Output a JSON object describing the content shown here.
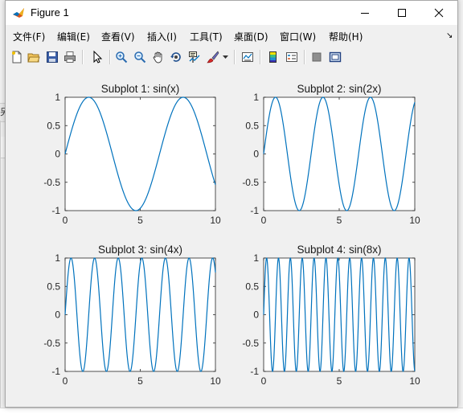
{
  "window": {
    "title": "Figure 1"
  },
  "menubar": {
    "items": [
      {
        "label": "文件(F)",
        "name": "menu-file"
      },
      {
        "label": "编辑(E)",
        "name": "menu-edit"
      },
      {
        "label": "查看(V)",
        "name": "menu-view"
      },
      {
        "label": "插入(I)",
        "name": "menu-insert"
      },
      {
        "label": "工具(T)",
        "name": "menu-tools"
      },
      {
        "label": "桌面(D)",
        "name": "menu-desktop"
      },
      {
        "label": "窗口(W)",
        "name": "menu-window"
      },
      {
        "label": "帮助(H)",
        "name": "menu-help"
      }
    ]
  },
  "toolbar": {
    "icons": [
      "new-figure-icon",
      "open-file-icon",
      "save-icon",
      "print-icon",
      "select-arrow-icon",
      "zoom-in-icon",
      "zoom-out-icon",
      "pan-hand-icon",
      "rotate-3d-icon",
      "data-cursor-icon",
      "brush-icon",
      "brush-dropdown-icon",
      "link-plot-icon",
      "insert-colorbar-icon",
      "insert-legend-icon",
      "hide-plot-tools-icon",
      "show-plot-tools-icon"
    ]
  },
  "colors": {
    "line": "#0072bd",
    "axes_bg": "#ffffff",
    "figure_bg": "#f0f0f0"
  },
  "chart_data": [
    {
      "type": "line",
      "title": "Subplot 1: sin(x)",
      "function": "sin(x)",
      "frequency": 1,
      "x": [
        0.0,
        0.5,
        1.0,
        1.5,
        2.0,
        2.5,
        3.0,
        3.5,
        4.0,
        4.5,
        5.0,
        5.5,
        6.0,
        6.5,
        7.0,
        7.5,
        8.0,
        8.5,
        9.0,
        9.5,
        10.0
      ],
      "y": [
        0.0,
        0.479,
        0.841,
        0.997,
        0.909,
        0.598,
        0.141,
        -0.351,
        -0.757,
        -0.978,
        -0.959,
        -0.706,
        -0.279,
        0.215,
        0.657,
        0.938,
        0.989,
        0.798,
        0.412,
        -0.075,
        -0.544
      ],
      "xlim": [
        0,
        10
      ],
      "ylim": [
        -1,
        1
      ],
      "xticks": [
        "0",
        "5",
        "10"
      ],
      "yticks": [
        "1",
        "0.5",
        "0",
        "-0.5",
        "-1"
      ],
      "grid": false
    },
    {
      "type": "line",
      "title": "Subplot 2: sin(2x)",
      "function": "sin(2x)",
      "frequency": 2,
      "x": [
        0.0,
        0.5,
        1.0,
        1.5,
        2.0,
        2.5,
        3.0,
        3.5,
        4.0,
        4.5,
        5.0,
        5.5,
        6.0,
        6.5,
        7.0,
        7.5,
        8.0,
        8.5,
        9.0,
        9.5,
        10.0
      ],
      "y": [
        0.0,
        0.841,
        0.909,
        0.141,
        -0.757,
        -0.959,
        -0.279,
        0.657,
        0.989,
        0.412,
        -0.544,
        -1.0,
        -0.537,
        0.42,
        0.991,
        0.65,
        -0.288,
        -0.961,
        -0.751,
        0.15,
        0.913
      ],
      "xlim": [
        0,
        10
      ],
      "ylim": [
        -1,
        1
      ],
      "xticks": [
        "0",
        "5",
        "10"
      ],
      "yticks": [
        "1",
        "0.5",
        "0",
        "-0.5",
        "-1"
      ],
      "grid": false
    },
    {
      "type": "line",
      "title": "Subplot 3: sin(4x)",
      "function": "sin(4x)",
      "frequency": 4,
      "x": [
        0.0,
        0.5,
        1.0,
        1.5,
        2.0,
        2.5,
        3.0,
        3.5,
        4.0,
        4.5,
        5.0,
        5.5,
        6.0,
        6.5,
        7.0,
        7.5,
        8.0,
        8.5,
        9.0,
        9.5,
        10.0
      ],
      "y": [
        0.0,
        0.909,
        -0.757,
        -0.279,
        0.989,
        -0.544,
        -0.537,
        0.991,
        -0.288,
        -0.751,
        0.913,
        0.009,
        -0.906,
        0.762,
        0.271,
        -0.988,
        0.551,
        0.529,
        -0.992,
        0.296,
        0.745
      ],
      "xlim": [
        0,
        10
      ],
      "ylim": [
        -1,
        1
      ],
      "xticks": [
        "0",
        "5",
        "10"
      ],
      "yticks": [
        "1",
        "0.5",
        "0",
        "-0.5",
        "-1"
      ],
      "grid": false
    },
    {
      "type": "line",
      "title": "Subplot 4: sin(8x)",
      "function": "sin(8x)",
      "frequency": 8,
      "x": [
        0.0,
        0.5,
        1.0,
        1.5,
        2.0,
        2.5,
        3.0,
        3.5,
        4.0,
        4.5,
        5.0,
        5.5,
        6.0,
        6.5,
        7.0,
        7.5,
        8.0,
        8.5,
        9.0,
        9.5,
        10.0
      ],
      "y": [
        0.0,
        -0.757,
        0.989,
        -0.537,
        -0.288,
        0.913,
        -0.906,
        0.271,
        0.551,
        -0.992,
        0.745,
        0.018,
        -0.768,
        0.987,
        -0.522,
        -0.305,
        0.92,
        -0.9,
        0.254,
        0.565,
        -0.994
      ],
      "xlim": [
        0,
        10
      ],
      "ylim": [
        -1,
        1
      ],
      "xticks": [
        "0",
        "5",
        "10"
      ],
      "yticks": [
        "1",
        "0.5",
        "0",
        "-0.5",
        "-1"
      ],
      "grid": false
    }
  ]
}
